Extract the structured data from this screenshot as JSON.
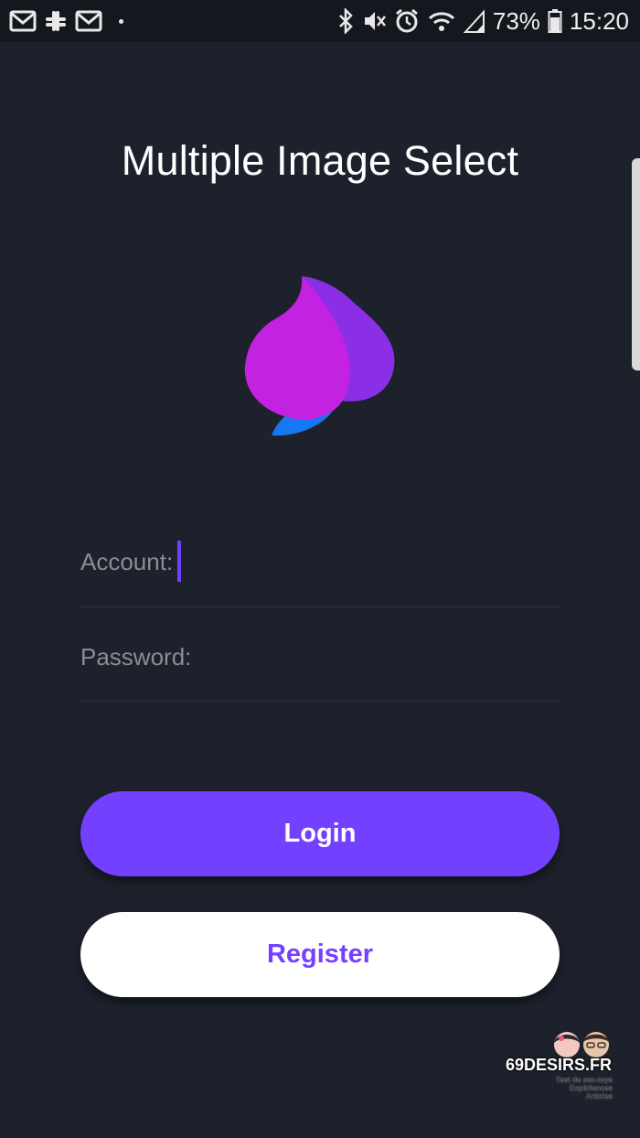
{
  "status_bar": {
    "battery": "73%",
    "time": "15:20",
    "icons_left": [
      "gmail-icon",
      "slack-icon",
      "gmail-icon",
      "dot"
    ],
    "icons_right": [
      "bluetooth-icon",
      "mute-icon",
      "alarm-icon",
      "wifi-icon",
      "signal-icon",
      "battery-icon"
    ]
  },
  "header": {
    "title": "Multiple Image Select"
  },
  "form": {
    "account_label": "Account:",
    "password_label": "Password:"
  },
  "buttons": {
    "login": "Login",
    "register": "Register"
  },
  "watermark": {
    "brand": "69DESIRS.FR",
    "tagline_1": "Test de sex-toys",
    "tagline_2": "Expériences",
    "tagline_3": "Articles"
  },
  "colors": {
    "background": "#1d212b",
    "accent": "#7440ff",
    "logo_magenta": "#c322e0",
    "logo_purple": "#8b2fe6",
    "logo_blue": "#1677f2"
  }
}
